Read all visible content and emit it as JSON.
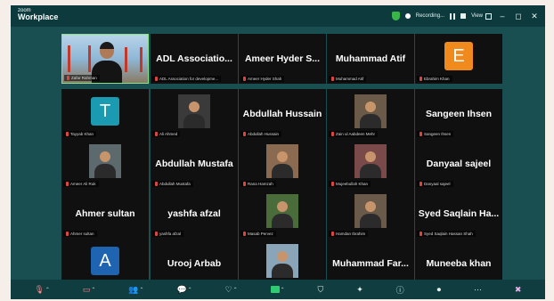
{
  "window": {
    "logo_line1": "zoom",
    "logo_line2": "Workplace",
    "recording_label": "Recording...",
    "view_label": "View"
  },
  "tiles": [
    {
      "type": "video",
      "name": "",
      "label": "Zafar Rahman",
      "active": true
    },
    {
      "type": "name",
      "name": "ADL Associatio...",
      "label": "ADL Association for developme..."
    },
    {
      "type": "name",
      "name": "Ameer Hyder S...",
      "label": "Ameer Hyder Shah"
    },
    {
      "type": "name",
      "name": "Muhammad Atif",
      "label": "Muhammad Atif"
    },
    {
      "type": "initial",
      "name": "E",
      "label": "Ebrahim Khan",
      "color": "#f08a1c"
    },
    {
      "type": "initial",
      "name": "T",
      "label": "Tayyab Khan",
      "color": "#1b9bb2"
    },
    {
      "type": "photo",
      "name": "",
      "label": "Ali Ahmed",
      "color": "#3a3a3a"
    },
    {
      "type": "name",
      "name": "Abdullah Hussain",
      "label": "Abdullah Hussain"
    },
    {
      "type": "photo",
      "name": "",
      "label": "Zain ul Aabdeen Mehr",
      "color": "#6b5a48"
    },
    {
      "type": "name",
      "name": "Sangeen Ihsen",
      "label": "Sangeen Ihsen"
    },
    {
      "type": "photo",
      "name": "",
      "label": "Ameer Ali Ruk",
      "color": "#5c6a6e"
    },
    {
      "type": "name",
      "name": "Abdullah Mustafa",
      "label": "Abdullah Mustafa"
    },
    {
      "type": "photo",
      "name": "",
      "label": "Rana Hamzah",
      "color": "#8a6b52"
    },
    {
      "type": "photo",
      "name": "",
      "label": "Mujeebullah Khan",
      "color": "#7a4a4a"
    },
    {
      "type": "name",
      "name": "Danyaal sajeel",
      "label": "Danyaal sajeel"
    },
    {
      "type": "name",
      "name": "Ahmer sultan",
      "label": "Ahmer sultan"
    },
    {
      "type": "name",
      "name": "yashfa afzal",
      "label": "yashfa afzal"
    },
    {
      "type": "photo",
      "name": "",
      "label": "Masab Pervez",
      "color": "#4a6b3a"
    },
    {
      "type": "photo",
      "name": "",
      "label": "Hamdan Ibrahim",
      "color": "#6a5a4a"
    },
    {
      "type": "name",
      "name": "Syed Saqlain Ha...",
      "label": "Syed Saqlain Hassan Shah"
    },
    {
      "type": "initial",
      "name": "A",
      "label": "Ayesha",
      "color": "#1e64b0"
    },
    {
      "type": "name",
      "name": "Urooj Arbab",
      "label": "Urooj Arbab"
    },
    {
      "type": "photo",
      "name": "",
      "label": "Muhammad Atif",
      "color": "#8aa4b8"
    },
    {
      "type": "name",
      "name": "Muhammad Far...",
      "label": "Muhammad Farhan Muhamma..."
    },
    {
      "type": "name",
      "name": "Muneeba khan",
      "label": "Muneebakhan"
    }
  ],
  "toolbar": [
    {
      "id": "audio",
      "icon": "mic-off-icon",
      "glyph": "🎙",
      "caret": true,
      "red": true
    },
    {
      "id": "video",
      "icon": "camera-off-icon",
      "glyph": "▭",
      "caret": true,
      "red": true
    },
    {
      "id": "participants",
      "icon": "participants-icon",
      "glyph": "👥",
      "caret": true
    },
    {
      "id": "chat",
      "icon": "chat-icon",
      "glyph": "💬",
      "caret": true
    },
    {
      "id": "react",
      "icon": "heart-icon",
      "glyph": "♡",
      "caret": true
    },
    {
      "id": "share",
      "icon": "share-screen-icon",
      "glyph": "",
      "caret": true,
      "green": true
    },
    {
      "id": "security",
      "icon": "shield-icon",
      "glyph": "⛉",
      "caret": false
    },
    {
      "id": "apps",
      "icon": "sparkle-icon",
      "glyph": "✦",
      "caret": false
    },
    {
      "id": "info",
      "icon": "info-icon",
      "glyph": "ⓘ",
      "caret": false
    },
    {
      "id": "record",
      "icon": "record-icon",
      "glyph": "⏺",
      "caret": false
    },
    {
      "id": "more",
      "icon": "more-icon",
      "glyph": "⋯",
      "caret": false
    },
    {
      "id": "leave",
      "icon": "leave-icon",
      "glyph": "✖",
      "caret": false
    }
  ]
}
